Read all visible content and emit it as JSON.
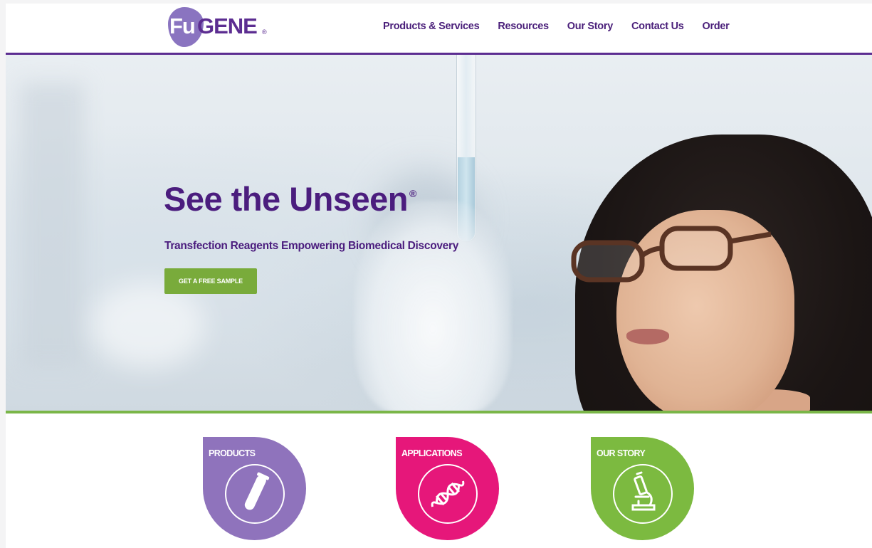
{
  "brand": {
    "logo_fu": "Fu",
    "logo_gene": "GENE",
    "logo_reg": "®"
  },
  "nav": {
    "items": [
      {
        "label": "Products & Services"
      },
      {
        "label": "Resources"
      },
      {
        "label": "Our Story"
      },
      {
        "label": "Contact Us"
      },
      {
        "label": "Order"
      }
    ]
  },
  "hero": {
    "title": "See the Unseen",
    "title_mark": "®",
    "subtitle": "Transfection Reagents Empowering Biomedical Discovery",
    "cta_label": "GET A FREE SAMPLE"
  },
  "features": [
    {
      "label": "PRODUCTS",
      "icon": "test-tube-icon",
      "color": "#8f73bc"
    },
    {
      "label": "APPLICATIONS",
      "icon": "dna-icon",
      "color": "#e6177a"
    },
    {
      "label": "OUR STORY",
      "icon": "microscope-icon",
      "color": "#7cba40"
    }
  ],
  "colors": {
    "brand_purple": "#4b1d7e",
    "accent_green": "#79ab3b",
    "header_rule": "#5c2d91"
  }
}
